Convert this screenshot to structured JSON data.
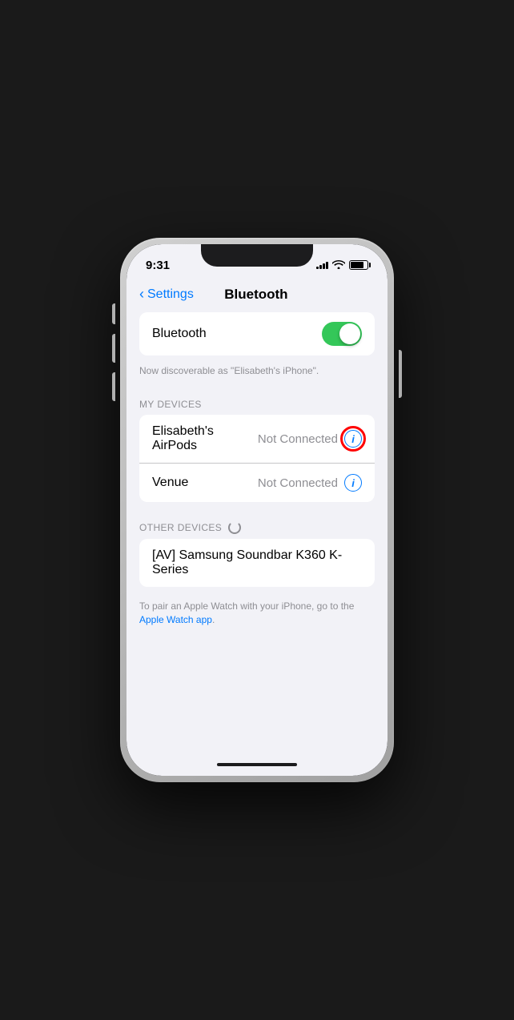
{
  "status_bar": {
    "time": "9:31",
    "signal_bars": [
      3,
      5,
      7,
      9,
      11
    ],
    "wifi": "wifi",
    "battery": 80
  },
  "nav": {
    "back_label": "Settings",
    "title": "Bluetooth"
  },
  "bluetooth_section": {
    "toggle_label": "Bluetooth",
    "toggle_on": true,
    "discoverable_text": "Now discoverable as \"Elisabeth's iPhone\"."
  },
  "my_devices": {
    "section_header": "MY DEVICES",
    "devices": [
      {
        "name": "Elisabeth's AirPods",
        "status": "Not Connected",
        "info": true,
        "highlighted": true
      },
      {
        "name": "Venue",
        "status": "Not Connected",
        "info": true,
        "highlighted": false
      }
    ]
  },
  "other_devices": {
    "section_header": "OTHER DEVICES",
    "show_spinner": true,
    "devices": [
      {
        "name": "[AV] Samsung Soundbar K360 K-Series"
      }
    ]
  },
  "footer": {
    "text": "To pair an Apple Watch with your iPhone, go to the ",
    "link_text": "Apple Watch app",
    "text_end": "."
  }
}
